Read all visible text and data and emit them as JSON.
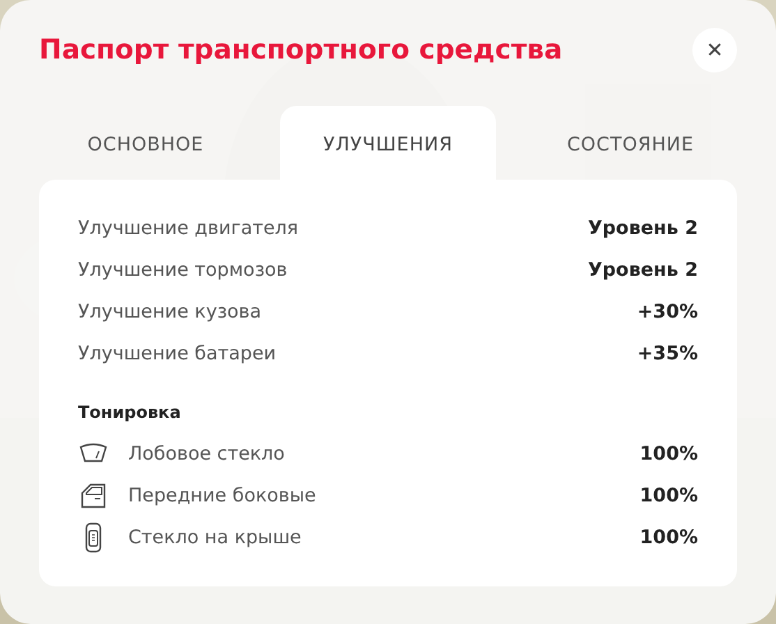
{
  "title": "Паспорт транспортного средства",
  "close": "✕",
  "tabs": [
    {
      "label": "ОСНОВНОЕ",
      "selected": false
    },
    {
      "label": "УЛУЧШЕНИЯ",
      "selected": true
    },
    {
      "label": "СОСТОЯНИЕ",
      "selected": false
    }
  ],
  "upgrades": [
    {
      "label": "Улучшение двигателя",
      "value": "Уровень 2"
    },
    {
      "label": "Улучшение тормозов",
      "value": "Уровень 2"
    },
    {
      "label": "Улучшение кузова",
      "value": "+30%"
    },
    {
      "label": "Улучшение батареи",
      "value": "+35%"
    }
  ],
  "tint": {
    "heading": "Тонировка",
    "items": [
      {
        "kind": "windshield",
        "label": "Лобовое стекло",
        "value": "100%"
      },
      {
        "kind": "door",
        "label": "Передние боковые",
        "value": "100%"
      },
      {
        "kind": "roof",
        "label": "Стекло на крыше",
        "value": "100%"
      }
    ]
  }
}
